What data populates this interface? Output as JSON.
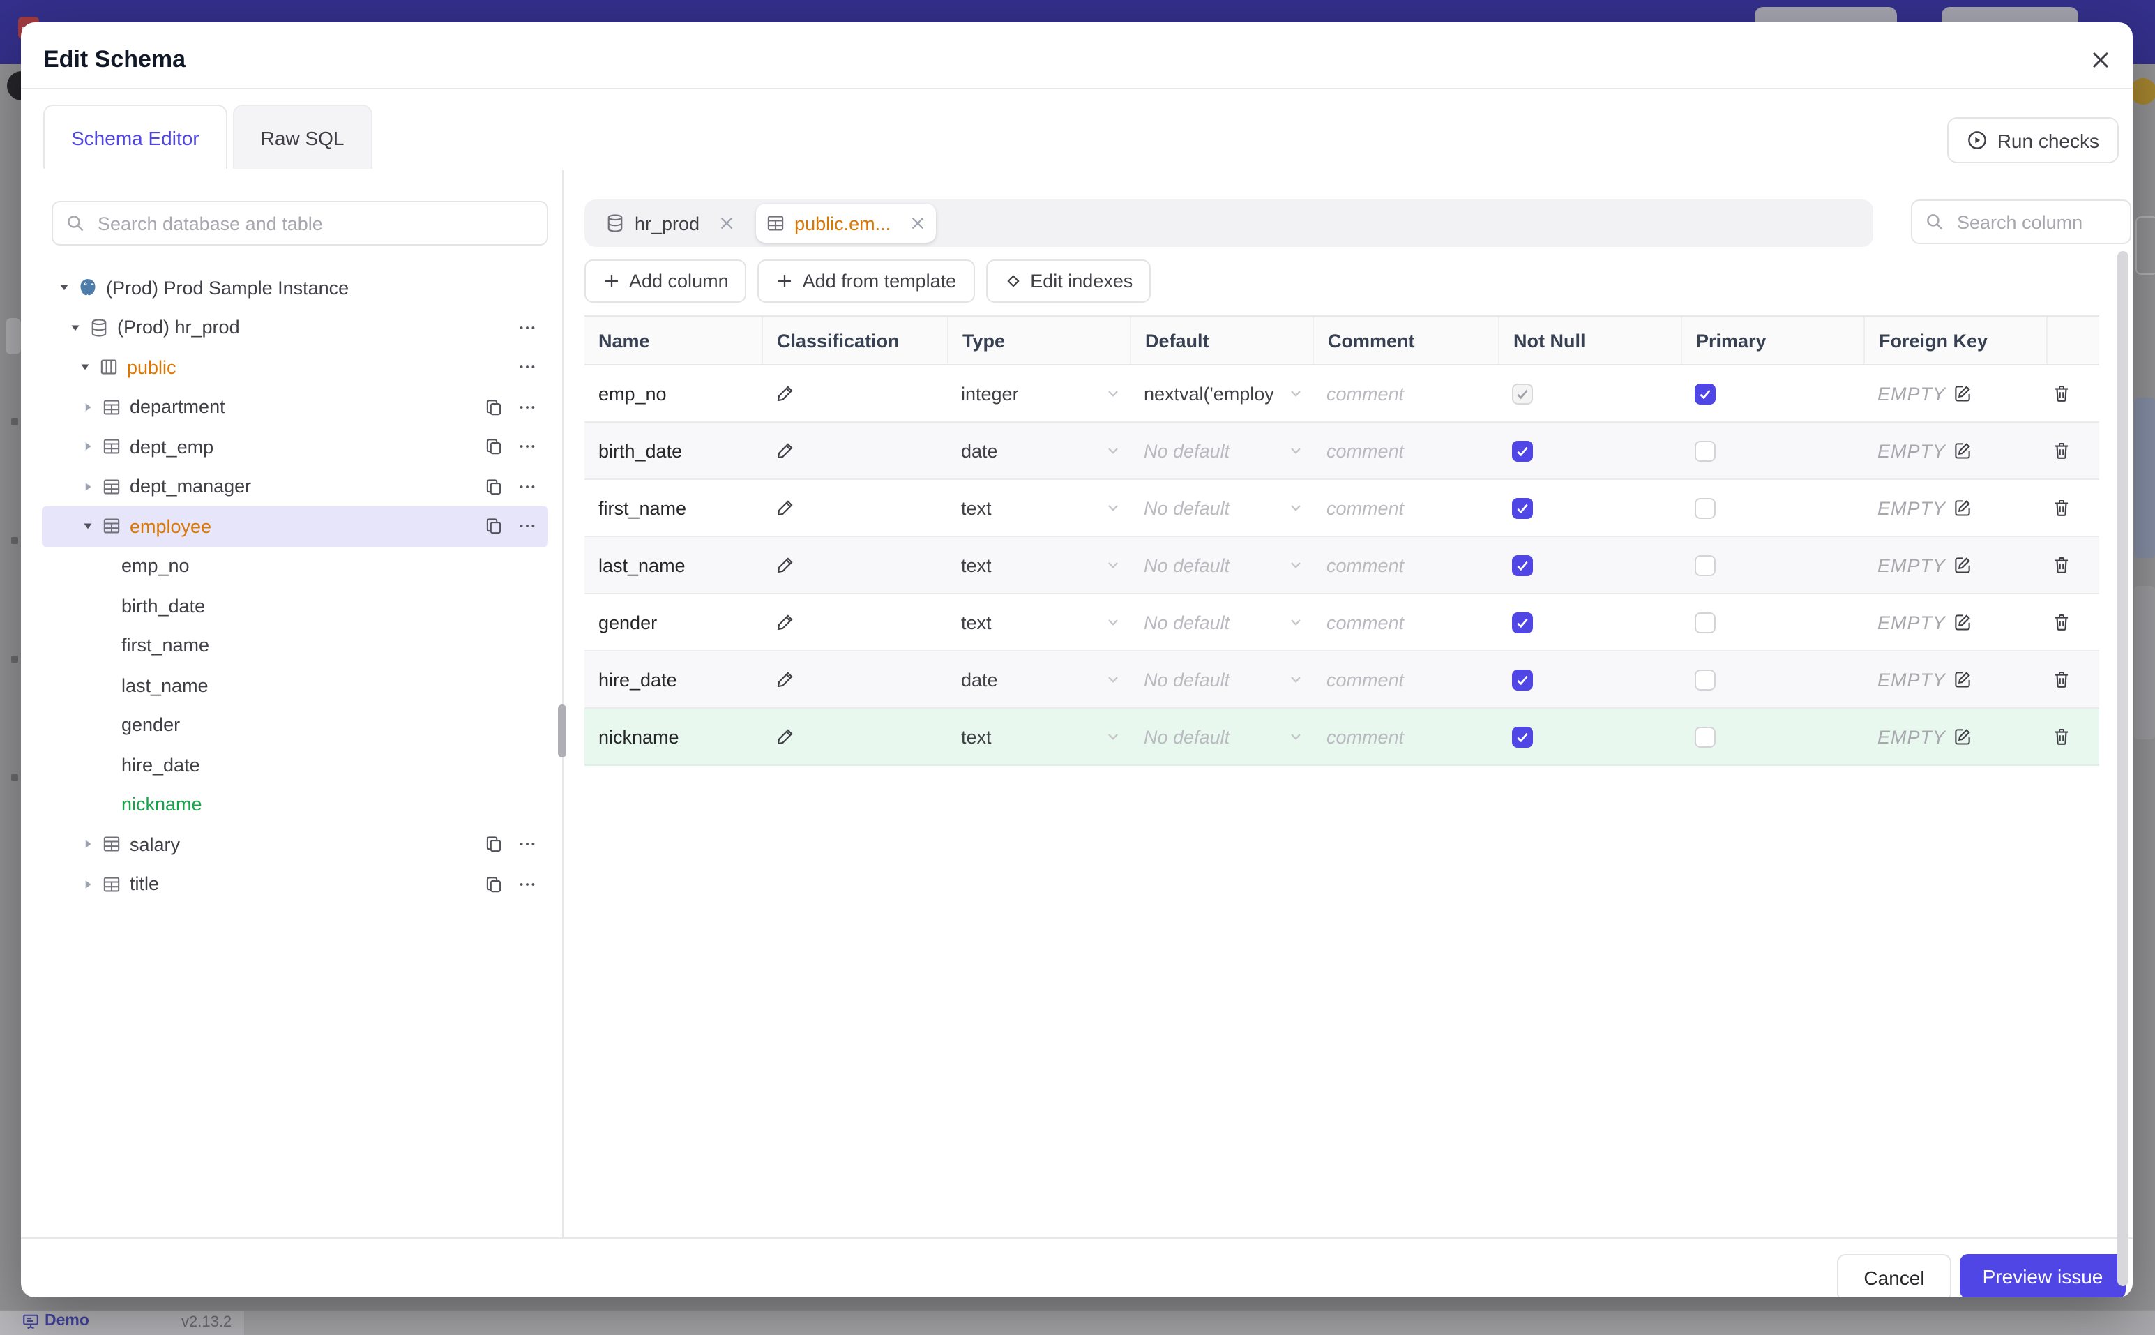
{
  "backdrop": {
    "topbar_color": "#34308c",
    "status": {
      "app_label": "Demo",
      "version": "v2.13.2"
    }
  },
  "modal": {
    "title": "Edit Schema",
    "tabs": [
      {
        "label": "Schema Editor",
        "active": true
      },
      {
        "label": "Raw SQL",
        "active": false
      }
    ],
    "run_checks_label": "Run checks",
    "sidebar": {
      "search_placeholder": "Search database and table",
      "tree": [
        {
          "level": 0,
          "icon": "postgres",
          "chevron": "open",
          "label": "(Prod) Prod Sample Instance"
        },
        {
          "level": 1,
          "icon": "database",
          "chevron": "open",
          "label": "(Prod) hr_prod",
          "menu": true
        },
        {
          "level": 2,
          "icon": "schema",
          "chevron": "open",
          "label": "public",
          "menu": true,
          "cls": "amber"
        },
        {
          "level": 3,
          "icon": "table",
          "chevron": "closed",
          "label": "department",
          "copy": true,
          "menu": true
        },
        {
          "level": 3,
          "icon": "table",
          "chevron": "closed",
          "label": "dept_emp",
          "copy": true,
          "menu": true
        },
        {
          "level": 3,
          "icon": "table",
          "chevron": "closed",
          "label": "dept_manager",
          "copy": true,
          "menu": true
        },
        {
          "level": 3,
          "icon": "table",
          "chevron": "open",
          "label": "employee",
          "copy": true,
          "menu": true,
          "cls": "amber",
          "selected": true
        },
        {
          "level": 4,
          "label": "emp_no"
        },
        {
          "level": 4,
          "label": "birth_date"
        },
        {
          "level": 4,
          "label": "first_name"
        },
        {
          "level": 4,
          "label": "last_name"
        },
        {
          "level": 4,
          "label": "gender"
        },
        {
          "level": 4,
          "label": "hire_date"
        },
        {
          "level": 4,
          "label": "nickname",
          "cls": "green"
        },
        {
          "level": 3,
          "icon": "table",
          "chevron": "closed",
          "label": "salary",
          "copy": true,
          "menu": true
        },
        {
          "level": 3,
          "icon": "table",
          "chevron": "closed",
          "label": "title",
          "copy": true,
          "menu": true
        }
      ]
    },
    "main": {
      "chips": [
        {
          "label": "hr_prod",
          "icon": "database",
          "active": false
        },
        {
          "label": "public.em...",
          "icon": "table",
          "active": true
        }
      ],
      "toolbar": [
        {
          "label": "Add column",
          "icon": "plus"
        },
        {
          "label": "Add from template",
          "icon": "plus"
        },
        {
          "label": "Edit indexes",
          "icon": "diamond"
        }
      ],
      "column_search_placeholder": "Search column",
      "table": {
        "headers": [
          "Name",
          "Classification",
          "Type",
          "Default",
          "Comment",
          "Not Null",
          "Primary",
          "Foreign Key",
          ""
        ],
        "comment_placeholder": "comment",
        "fk_label": "EMPTY",
        "rows": [
          {
            "name": "emp_no",
            "type": "integer",
            "default": "nextval('employ",
            "default_is_value": true,
            "not_null": true,
            "not_null_disabled": true,
            "primary": true,
            "added": false
          },
          {
            "name": "birth_date",
            "type": "date",
            "default": "No default",
            "default_is_value": false,
            "not_null": true,
            "not_null_disabled": false,
            "primary": false,
            "added": false
          },
          {
            "name": "first_name",
            "type": "text",
            "default": "No default",
            "default_is_value": false,
            "not_null": true,
            "not_null_disabled": false,
            "primary": false,
            "added": false
          },
          {
            "name": "last_name",
            "type": "text",
            "default": "No default",
            "default_is_value": false,
            "not_null": true,
            "not_null_disabled": false,
            "primary": false,
            "added": false
          },
          {
            "name": "gender",
            "type": "text",
            "default": "No default",
            "default_is_value": false,
            "not_null": true,
            "not_null_disabled": false,
            "primary": false,
            "added": false
          },
          {
            "name": "hire_date",
            "type": "date",
            "default": "No default",
            "default_is_value": false,
            "not_null": true,
            "not_null_disabled": false,
            "primary": false,
            "added": false
          },
          {
            "name": "nickname",
            "type": "text",
            "default": "No default",
            "default_is_value": false,
            "not_null": true,
            "not_null_disabled": false,
            "primary": false,
            "added": true
          }
        ]
      }
    },
    "footer": {
      "cancel_label": "Cancel",
      "primary_label": "Preview issue"
    }
  },
  "colors": {
    "accent": "#4f46e5",
    "amber_text": "#d97706",
    "green_text": "#16a34a",
    "added_row_bg": "#e9f8ef",
    "selected_tree_bg": "#e7e5fa"
  }
}
